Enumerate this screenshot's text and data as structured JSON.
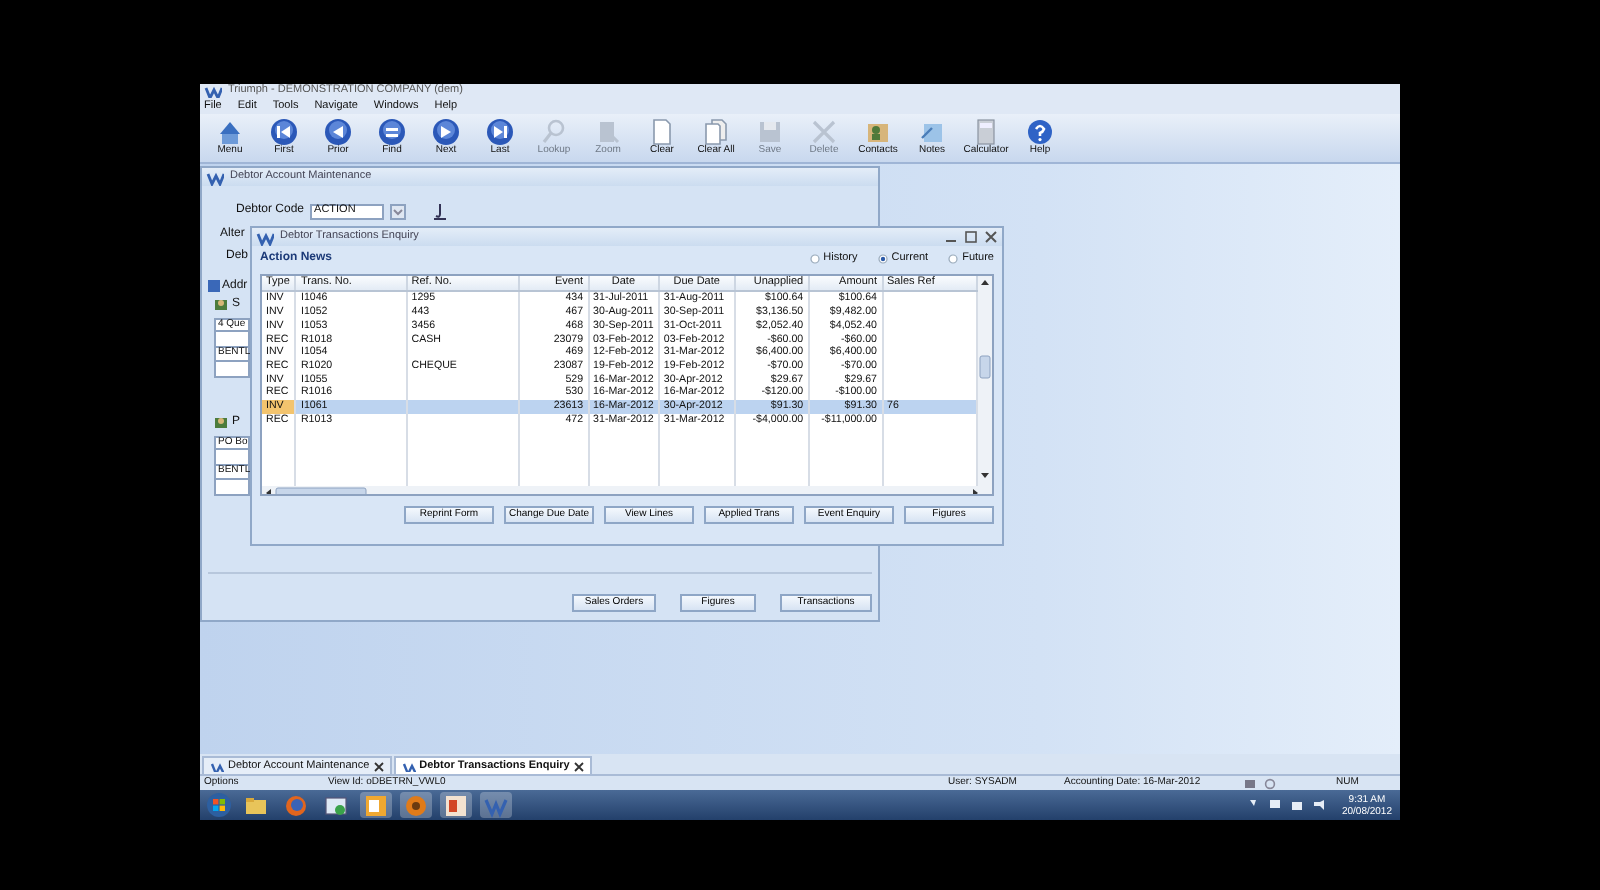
{
  "app_title": "Triumph - DEMONSTRATION COMPANY (dem)",
  "menu": [
    "File",
    "Edit",
    "Tools",
    "Navigate",
    "Windows",
    "Help"
  ],
  "toolbar": [
    {
      "label": "Menu",
      "kind": "menu",
      "disabled": false
    },
    {
      "label": "First",
      "kind": "first",
      "disabled": false
    },
    {
      "label": "Prior",
      "kind": "prior",
      "disabled": false
    },
    {
      "label": "Find",
      "kind": "find",
      "disabled": false
    },
    {
      "label": "Next",
      "kind": "next",
      "disabled": false
    },
    {
      "label": "Last",
      "kind": "last",
      "disabled": false
    },
    {
      "label": "Lookup",
      "kind": "lookup",
      "disabled": true
    },
    {
      "label": "Zoom",
      "kind": "zoom",
      "disabled": true
    },
    {
      "label": "Clear",
      "kind": "clear",
      "disabled": false
    },
    {
      "label": "Clear All",
      "kind": "clear-all",
      "disabled": false
    },
    {
      "label": "Save",
      "kind": "save",
      "disabled": true
    },
    {
      "label": "Delete",
      "kind": "delete",
      "disabled": true
    },
    {
      "label": "Contacts",
      "kind": "contacts",
      "disabled": false
    },
    {
      "label": "Notes",
      "kind": "notes",
      "disabled": false
    },
    {
      "label": "Calculator",
      "kind": "calculator",
      "disabled": false
    },
    {
      "label": "Help",
      "kind": "help",
      "disabled": false
    }
  ],
  "maintenance_window": {
    "title": "Debtor Account Maintenance",
    "debtor_code_label": "Debtor Code",
    "debtor_code": "ACTION",
    "partial_labels": [
      "Alter",
      "Deb"
    ],
    "address_tab": "Addr",
    "street_label": "S",
    "street_lines": [
      "4 Que",
      "BENTL"
    ],
    "postal_label": "P",
    "postal_lines": [
      "PO Bo",
      "BENTL"
    ],
    "buttons": [
      "Sales Orders",
      "Figures",
      "Transactions"
    ]
  },
  "enquiry_window": {
    "title": "Debtor Transactions Enquiry",
    "debtor_name": "Action News",
    "views": [
      {
        "label": "History",
        "selected": false
      },
      {
        "label": "Current",
        "selected": true
      },
      {
        "label": "Future",
        "selected": false
      }
    ],
    "table": {
      "columns": [
        "Type",
        "Trans. No.",
        "Ref. No.",
        "Event",
        "Date",
        "Due Date",
        "Unapplied",
        "Amount",
        "Sales Ref"
      ],
      "rows": [
        {
          "cells": [
            "INV",
            "I1046",
            "1295",
            "434",
            "31-Jul-2011",
            "31-Aug-2011",
            "$100.64",
            "$100.64",
            ""
          ],
          "selected": false
        },
        {
          "cells": [
            "INV",
            "I1052",
            "443",
            "467",
            "30-Aug-2011",
            "30-Sep-2011",
            "$3,136.50",
            "$9,482.00",
            ""
          ],
          "selected": false
        },
        {
          "cells": [
            "INV",
            "I1053",
            "3456",
            "468",
            "30-Sep-2011",
            "31-Oct-2011",
            "$2,052.40",
            "$4,052.40",
            ""
          ],
          "selected": false
        },
        {
          "cells": [
            "REC",
            "R1018",
            "CASH",
            "23079",
            "03-Feb-2012",
            "03-Feb-2012",
            "-$60.00",
            "-$60.00",
            ""
          ],
          "selected": false
        },
        {
          "cells": [
            "INV",
            "I1054",
            "",
            "469",
            "12-Feb-2012",
            "31-Mar-2012",
            "$6,400.00",
            "$6,400.00",
            ""
          ],
          "selected": false
        },
        {
          "cells": [
            "REC",
            "R1020",
            "CHEQUE",
            "23087",
            "19-Feb-2012",
            "19-Feb-2012",
            "-$70.00",
            "-$70.00",
            ""
          ],
          "selected": false
        },
        {
          "cells": [
            "INV",
            "I1055",
            "",
            "529",
            "16-Mar-2012",
            "30-Apr-2012",
            "$29.67",
            "$29.67",
            ""
          ],
          "selected": false
        },
        {
          "cells": [
            "REC",
            "R1016",
            "",
            "530",
            "16-Mar-2012",
            "16-Mar-2012",
            "-$120.00",
            "-$100.00",
            ""
          ],
          "selected": false
        },
        {
          "cells": [
            "INV",
            "I1061",
            "",
            "23613",
            "16-Mar-2012",
            "30-Apr-2012",
            "$91.30",
            "$91.30",
            "76"
          ],
          "selected": true
        },
        {
          "cells": [
            "REC",
            "R1013",
            "",
            "472",
            "31-Mar-2012",
            "31-Mar-2012",
            "-$4,000.00",
            "-$11,000.00",
            ""
          ],
          "selected": false
        }
      ]
    },
    "buttons": [
      "Reprint Form",
      "Change Due Date",
      "View Lines",
      "Applied Trans",
      "Event Enquiry",
      "Figures"
    ]
  },
  "document_tabs": [
    {
      "label": "Debtor Account Maintenance",
      "selected": false
    },
    {
      "label": "Debtor Transactions Enquiry",
      "selected": true
    }
  ],
  "status_bar": {
    "options": "Options",
    "view_id": "View Id: oDBETRN_VWL0",
    "user": "User: SYSADM",
    "accounting_date": "Accounting Date: 16-Mar-2012",
    "num": "NUM"
  },
  "taskbar": {
    "time": "9:31 AM",
    "date": "20/08/2012"
  }
}
